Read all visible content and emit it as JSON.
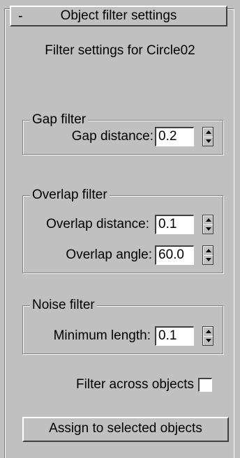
{
  "rollout": {
    "toggle_symbol": "-",
    "title": "Object filter settings"
  },
  "subtitle": "Filter settings for Circle02",
  "gap_filter": {
    "legend": "Gap filter",
    "gap_distance_label": "Gap distance:",
    "gap_distance_value": "0.2"
  },
  "overlap_filter": {
    "legend": "Overlap filter",
    "overlap_distance_label": "Overlap distance:",
    "overlap_distance_value": "0.1",
    "overlap_angle_label": "Overlap angle:",
    "overlap_angle_value": "60.0"
  },
  "noise_filter": {
    "legend": "Noise filter",
    "minimum_length_label": "Minimum length:",
    "minimum_length_value": "0.1"
  },
  "filter_across_objects": {
    "label": "Filter across objects",
    "checked": false
  },
  "assign_button": {
    "label": "Assign to selected objects"
  }
}
